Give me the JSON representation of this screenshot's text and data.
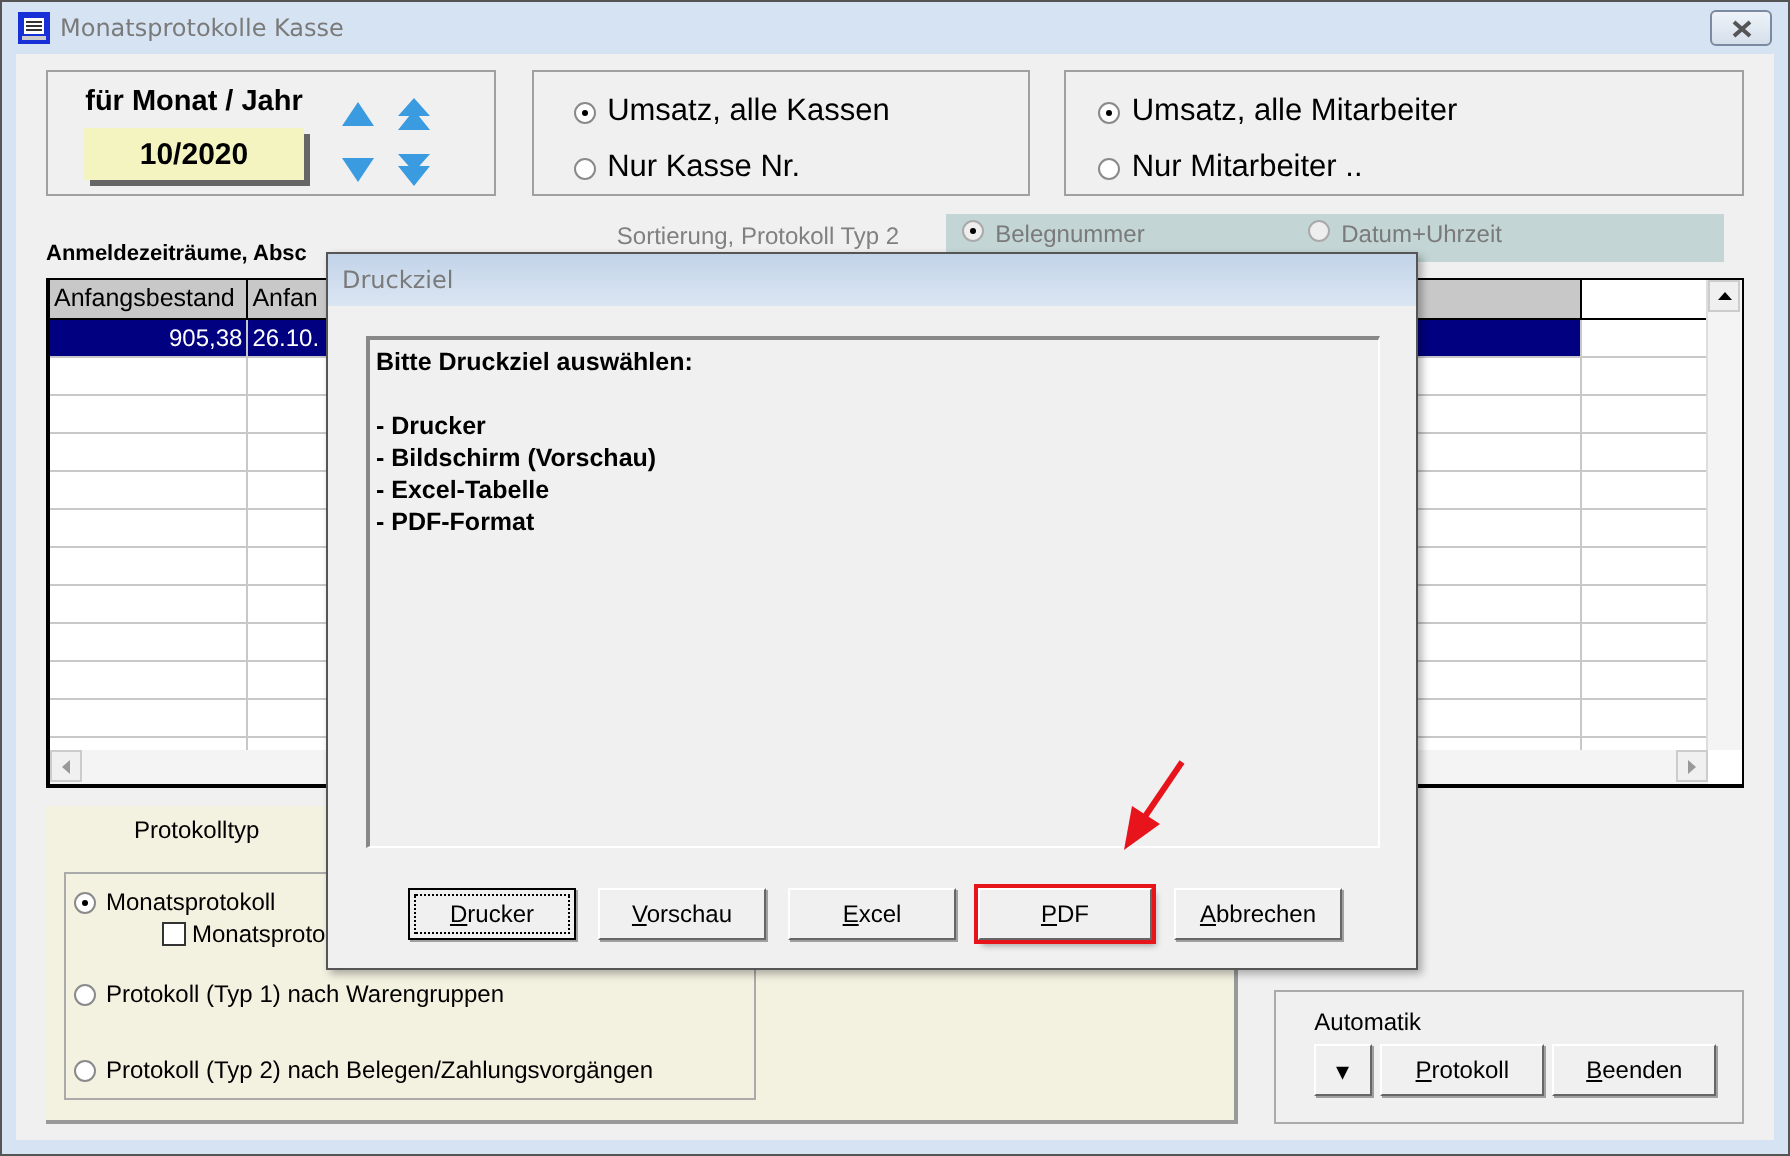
{
  "window": {
    "title": "Monatsprotokolle Kasse"
  },
  "period": {
    "label": "für Monat / Jahr",
    "value": "10/2020"
  },
  "kasse_options": [
    {
      "label": "Umsatz, alle Kassen",
      "selected": true
    },
    {
      "label": "Nur Kasse Nr.",
      "selected": false
    }
  ],
  "mitarbeiter_options": [
    {
      "label": "Umsatz, alle Mitarbeiter",
      "selected": true
    },
    {
      "label": "Nur Mitarbeiter ..",
      "selected": false
    }
  ],
  "sort": {
    "label": "Sortierung, Protokoll Typ 2",
    "disabled": true,
    "options": [
      {
        "label": "Belegnummer",
        "selected": true
      },
      {
        "label": "Datum+Uhrzeit",
        "selected": false
      }
    ]
  },
  "table": {
    "caption": "Anmeldezeiträume, Absc",
    "columns": [
      "Anfangsbestand",
      "Anfan"
    ],
    "rows": [
      {
        "cells": [
          "905,38",
          "26.10."
        ],
        "selected": true
      }
    ]
  },
  "protokolltyp": {
    "title": "Protokolltyp",
    "options": [
      {
        "label": "Monatsprotokoll",
        "selected": true
      },
      {
        "label": "Protokoll (Typ 1) nach Warengruppen",
        "selected": false
      },
      {
        "label": "Protokoll (Typ 2) nach Belegen/Zahlungsvorgängen",
        "selected": false
      }
    ],
    "checkbox": {
      "label": "Monatsproto",
      "checked": false
    }
  },
  "automatik": {
    "title": "Automatik",
    "dropdown": "▾",
    "buttons": [
      "Protokoll",
      "Beenden"
    ]
  },
  "dialog": {
    "title": "Druckziel",
    "heading": "Bitte Druckziel auswählen:",
    "lines": [
      "- Drucker",
      "- Bildschirm (Vorschau)",
      "- Excel-Tabelle",
      "- PDF-Format"
    ],
    "buttons": [
      {
        "label": "Drucker",
        "focused": true,
        "highlighted": false
      },
      {
        "label": "Vorschau",
        "focused": false,
        "highlighted": false
      },
      {
        "label": "Excel",
        "focused": false,
        "highlighted": false
      },
      {
        "label": "PDF",
        "focused": false,
        "highlighted": true
      },
      {
        "label": "Abbrechen",
        "focused": false,
        "highlighted": false
      }
    ]
  }
}
